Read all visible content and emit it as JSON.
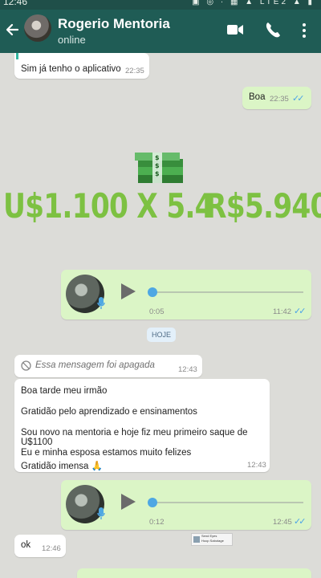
{
  "status_bar": {
    "time": "12:46",
    "icons": "▣ ◎ ·  ▦ ▲ LTE2 ▲ ▮"
  },
  "header": {
    "contact_name": "Rogerio Mentoria",
    "status": "online"
  },
  "messages": {
    "m1": {
      "text": "Sim já tenho o aplicativo",
      "time": "22:35"
    },
    "m2": {
      "text": "Boa",
      "time": "22:35"
    },
    "overlay": {
      "left": "U$1.100 X 5.4",
      "right": "R$5.940"
    },
    "audio1": {
      "duration": "0:05",
      "time": "11:42"
    },
    "day_divider": "HOJE",
    "deleted": {
      "text": "Essa mensagem foi apagada",
      "time": "12:43"
    },
    "long": {
      "line1": "Boa tarde meu irmão",
      "line2": "Gratidão pelo aprendizado e ensinamentos",
      "line3": "Sou novo na mentoria e hoje fiz meu primeiro saque de U$1100",
      "line4": "Eu e minha esposa estamos muito felizes",
      "line5": "Gratidão imensa 🙏",
      "time": "12:43"
    },
    "audio2": {
      "duration": "0:12",
      "time": "12:45"
    },
    "ok": {
      "text": "ok",
      "time": "12:46"
    },
    "sticker": {
      "line1": "Send Eyes",
      "line2": "Hoop Sabotage"
    }
  }
}
